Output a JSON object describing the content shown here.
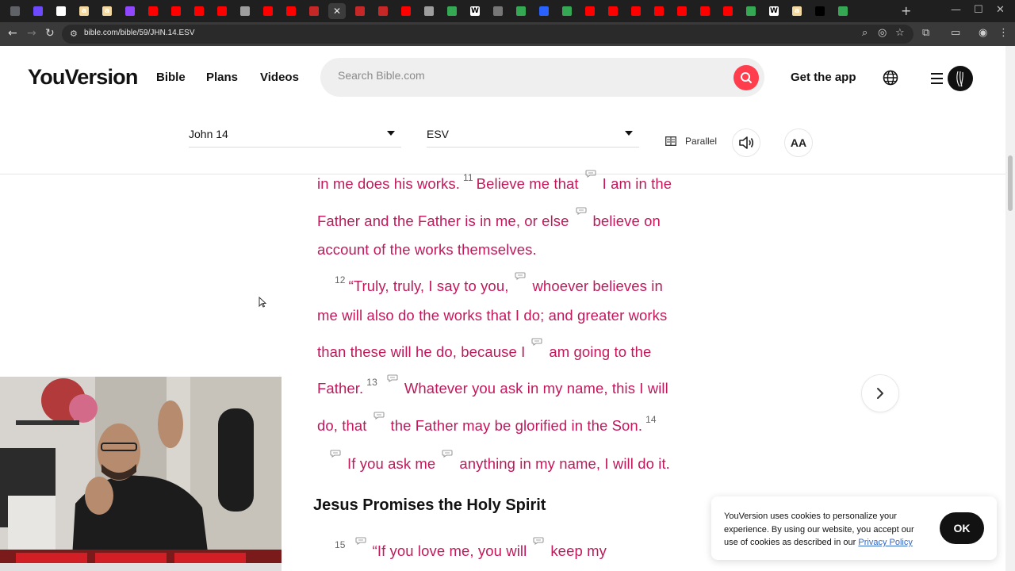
{
  "browser": {
    "url": "bible.com/bible/59/JHN.14.ESV",
    "tab_favicons": [
      {
        "icon": "chrome-icon",
        "color": "#5f6368",
        "glyph": ""
      },
      {
        "icon": "proton-icon",
        "color": "#6d4aff",
        "glyph": ""
      },
      {
        "icon": "stripe-icon",
        "color": "#ffffff",
        "glyph": ""
      },
      {
        "icon": "amazon-icon",
        "color": "#f3d9a0",
        "glyph": "a"
      },
      {
        "icon": "amazon-icon",
        "color": "#f3d9a0",
        "glyph": "a"
      },
      {
        "icon": "twitch-icon",
        "color": "#9146ff",
        "glyph": ""
      },
      {
        "icon": "youtube-icon",
        "color": "#ff0000",
        "glyph": ""
      },
      {
        "icon": "youtube-icon",
        "color": "#ff0000",
        "glyph": ""
      },
      {
        "icon": "youtube-icon",
        "color": "#ff0000",
        "glyph": ""
      },
      {
        "icon": "youtube-icon",
        "color": "#ff0000",
        "glyph": ""
      },
      {
        "icon": "globe-icon",
        "color": "#9e9e9e",
        "glyph": ""
      },
      {
        "icon": "youtube-icon",
        "color": "#ff0000",
        "glyph": ""
      },
      {
        "icon": "youtube-icon",
        "color": "#ff0000",
        "glyph": ""
      },
      {
        "icon": "youversion-icon",
        "color": "#c62828",
        "glyph": ""
      },
      {
        "icon": "youversion-icon",
        "color": "#c62828",
        "glyph": ""
      },
      {
        "icon": "youversion-icon",
        "color": "#c62828",
        "glyph": ""
      },
      {
        "icon": "youversion-icon",
        "color": "#c62828",
        "glyph": ""
      },
      {
        "icon": "youtube-icon",
        "color": "#ff0000",
        "glyph": ""
      },
      {
        "icon": "puzzle-icon",
        "color": "#9e9e9e",
        "glyph": ""
      },
      {
        "icon": "google-icon",
        "color": "#34a853",
        "glyph": ""
      },
      {
        "icon": "wikipedia-icon",
        "color": "#ffffff",
        "glyph": "W"
      },
      {
        "icon": "dash-icon",
        "color": "#777777",
        "glyph": ""
      },
      {
        "icon": "google-icon",
        "color": "#34a853",
        "glyph": ""
      },
      {
        "icon": "vpn-icon",
        "color": "#2962ff",
        "glyph": ""
      },
      {
        "icon": "google-icon",
        "color": "#34a853",
        "glyph": ""
      },
      {
        "icon": "youtube-icon",
        "color": "#ff0000",
        "glyph": ""
      },
      {
        "icon": "youtube-icon",
        "color": "#ff0000",
        "glyph": ""
      },
      {
        "icon": "youtube-icon",
        "color": "#ff0000",
        "glyph": ""
      },
      {
        "icon": "youtube-icon",
        "color": "#ff0000",
        "glyph": ""
      },
      {
        "icon": "youtube-icon",
        "color": "#ff0000",
        "glyph": ""
      },
      {
        "icon": "youtube-icon",
        "color": "#ff0000",
        "glyph": ""
      },
      {
        "icon": "youtube-icon",
        "color": "#ff0000",
        "glyph": ""
      },
      {
        "icon": "google-icon",
        "color": "#34a853",
        "glyph": ""
      },
      {
        "icon": "wikipedia-icon",
        "color": "#ffffff",
        "glyph": "W"
      },
      {
        "icon": "amazon-icon",
        "color": "#f3d9a0",
        "glyph": "a"
      },
      {
        "icon": "threads-icon",
        "color": "#000000",
        "glyph": ""
      },
      {
        "icon": "google-icon",
        "color": "#34a853",
        "glyph": ""
      }
    ],
    "active_tab_index": 14
  },
  "header": {
    "logo": "YouVersion",
    "nav": [
      "Bible",
      "Plans",
      "Videos"
    ],
    "search_placeholder": "Search Bible.com",
    "get_app": "Get the app",
    "accent_color": "#ff3d4d"
  },
  "reader": {
    "book_chapter": "John 14",
    "version": "ESV",
    "parallel_label": "Parallel",
    "font_button": "AA"
  },
  "scripture": {
    "text_color": "#c2185b",
    "lines": [
      {
        "parts": [
          {
            "t": "in me does his works."
          },
          {
            "v": "11"
          },
          {
            "t": "Believe me that"
          },
          {
            "n": true
          },
          {
            "t": "I am in the"
          }
        ]
      },
      {
        "parts": [
          {
            "t": "Father and the Father is in me, or else"
          },
          {
            "n": true
          },
          {
            "t": "believe on"
          }
        ]
      },
      {
        "parts": [
          {
            "t": "account of the works themselves."
          }
        ]
      },
      {
        "parts": [
          {
            "v": "12"
          },
          {
            "t": "“Truly, truly, I say to you,"
          },
          {
            "n": true
          },
          {
            "t": "whoever believes in"
          }
        ]
      },
      {
        "parts": [
          {
            "t": "me will also do the works that I do; and greater works"
          }
        ]
      },
      {
        "parts": [
          {
            "t": "than these will he do, because I"
          },
          {
            "n": true
          },
          {
            "t": "am going to the"
          }
        ]
      },
      {
        "parts": [
          {
            "t": "Father."
          },
          {
            "v": "13"
          },
          {
            "n": true
          },
          {
            "t": "Whatever you ask in my name, this I will"
          }
        ]
      },
      {
        "parts": [
          {
            "t": "do, that"
          },
          {
            "n": true
          },
          {
            "t": "the Father may be glorified in the Son."
          },
          {
            "v": "14"
          }
        ]
      },
      {
        "parts": [
          {
            "n": true
          },
          {
            "t": "If you ask me"
          },
          {
            "n": true
          },
          {
            "t": "anything in my name, I will do it."
          }
        ]
      }
    ],
    "heading": "Jesus Promises the Holy Spirit",
    "after_heading": [
      {
        "parts": [
          {
            "v": "15"
          },
          {
            "n": true
          },
          {
            "t": "“If you love me, you will"
          },
          {
            "n": true
          },
          {
            "t": "keep my"
          }
        ]
      }
    ]
  },
  "cookie": {
    "text": "YouVersion uses cookies to personalize your experience. By using our website, you accept our use of cookies as described in our",
    "link": "Privacy Policy",
    "ok": "OK"
  }
}
